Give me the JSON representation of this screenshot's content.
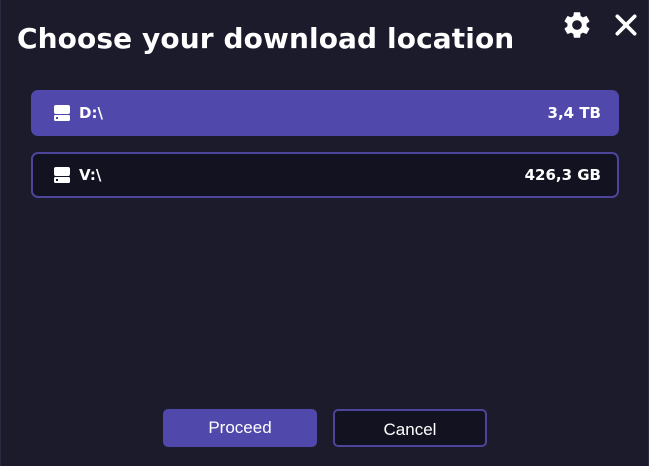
{
  "dialog": {
    "title": "Choose your download location",
    "settings_icon": "gear-icon",
    "close_icon": "close-icon"
  },
  "drives": [
    {
      "name": "D:\\",
      "size": "3,4 TB",
      "icon": "hard-drive-icon",
      "selected": true
    },
    {
      "name": "V:\\",
      "size": "426,3 GB",
      "icon": "hard-drive-icon",
      "selected": false
    }
  ],
  "buttons": {
    "proceed_label": "Proceed",
    "cancel_label": "Cancel"
  },
  "colors": {
    "background": "#1c1b2c",
    "accent": "#5048ab",
    "outline": "#4c4599",
    "text": "#ffffff"
  }
}
